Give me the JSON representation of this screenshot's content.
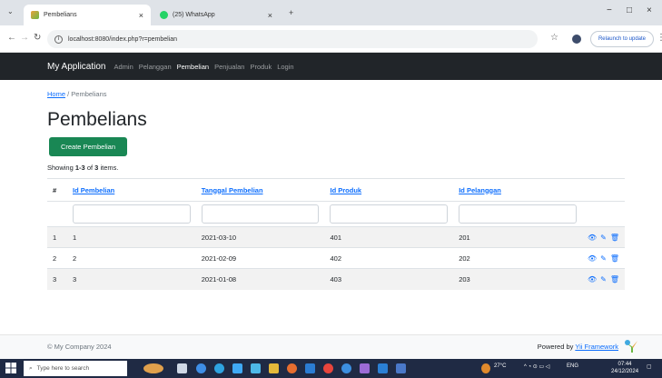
{
  "browser": {
    "tabs": [
      {
        "title": "Pembelians",
        "close": "×"
      },
      {
        "title": "(25) WhatsApp",
        "close": "×"
      }
    ],
    "new_tab": "+",
    "url": "localhost:8080/index.php?r=pembelian",
    "relaunch_label": "Relaunch to update",
    "window_controls": [
      "−",
      "□",
      "×"
    ]
  },
  "navbar": {
    "brand": "My Application",
    "links": [
      "Admin",
      "Pelanggan",
      "Pembelian",
      "Penjualan",
      "Produk",
      "Login"
    ],
    "active_index": 2
  },
  "breadcrumb": {
    "home": "Home",
    "separator": "/",
    "current": "Pembelians"
  },
  "page": {
    "title": "Pembelians",
    "create_button": "Create Pembelian",
    "summary_prefix": "Showing",
    "summary_range": "1-3",
    "summary_of": "of",
    "summary_total": "3",
    "summary_suffix": "items."
  },
  "table": {
    "headers": [
      "#",
      "Id Pembelian",
      "Tanggal Pembelian",
      "Id Produk",
      "Id Pelanggan"
    ],
    "rows": [
      [
        "1",
        "1",
        "2021-03-10",
        "401",
        "201"
      ],
      [
        "2",
        "2",
        "2021-02-09",
        "402",
        "202"
      ],
      [
        "3",
        "3",
        "2021-01-08",
        "403",
        "203"
      ]
    ],
    "action_icons": [
      "eye-icon",
      "pencil-icon",
      "trash-icon"
    ]
  },
  "footer": {
    "copyright": "© My Company 2024",
    "powered_prefix": "Powered by",
    "powered_link": "Yii Framework"
  },
  "taskbar": {
    "search_placeholder": "Type here to search",
    "weather": "27°C",
    "language": "ENG",
    "time": "07:44",
    "date": "24/12/2024"
  },
  "colors": {
    "navbar_bg": "#212529",
    "link": "#0d6efd",
    "create_button": "#198754",
    "taskbar": "#1f2a44"
  }
}
